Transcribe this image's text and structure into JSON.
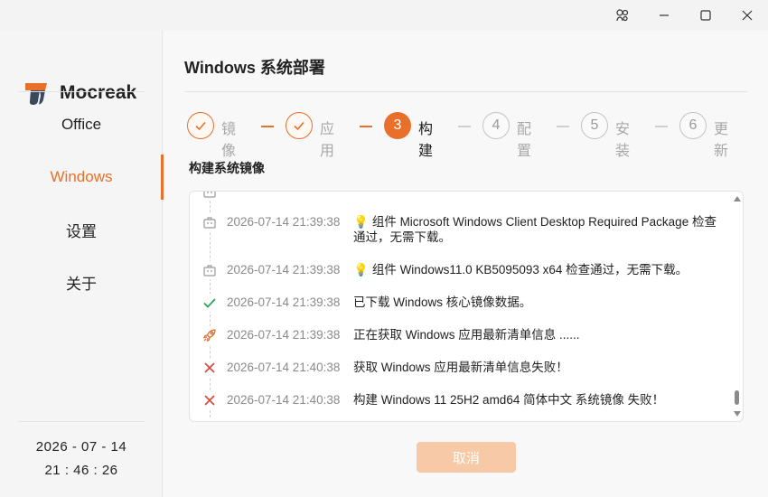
{
  "window": {
    "controls": [
      "settings-icon",
      "minimize-icon",
      "maximize-icon",
      "close-icon"
    ]
  },
  "brand": {
    "name": "Mocreak",
    "accent": "#e8702a"
  },
  "sidebar": {
    "items": [
      {
        "label": "Office",
        "active": false
      },
      {
        "label": "Windows",
        "active": true
      },
      {
        "label": "设置",
        "active": false
      },
      {
        "label": "关于",
        "active": false
      }
    ],
    "clock": {
      "date": "2026 - 07 - 14",
      "time": "21 : 46 : 26"
    }
  },
  "main": {
    "title": "Windows 系统部署",
    "steps": [
      {
        "index": "1",
        "label": "镜像",
        "state": "done"
      },
      {
        "index": "2",
        "label": "应用",
        "state": "done"
      },
      {
        "index": "3",
        "label": "构建",
        "state": "current"
      },
      {
        "index": "4",
        "label": "配置",
        "state": "todo"
      },
      {
        "index": "5",
        "label": "安装",
        "state": "todo"
      },
      {
        "index": "6",
        "label": "更新",
        "state": "todo"
      }
    ],
    "section_title": "构建系统镜像",
    "log": [
      {
        "icon": "package-icon",
        "time": "2026-07-14 21:39:38",
        "message": "组件 Microsoft Windows Client Desktop Required Package 检查通过，无需下载。",
        "bulb": true
      },
      {
        "icon": "package-icon",
        "time": "2026-07-14 21:39:38",
        "message": "组件 Windows11.0 KB5095093 x64 检查通过，无需下载。",
        "bulb": true
      },
      {
        "icon": "check-icon",
        "time": "2026-07-14 21:39:38",
        "message": "已下载 Windows 核心镜像数据。",
        "bulb": false
      },
      {
        "icon": "rocket-icon",
        "time": "2026-07-14 21:39:38",
        "message": "正在获取 Windows 应用最新清单信息 ......",
        "bulb": false
      },
      {
        "icon": "error-icon",
        "time": "2026-07-14 21:40:38",
        "message": "获取 Windows 应用最新清单信息失败！",
        "bulb": false
      },
      {
        "icon": "error-icon",
        "time": "2026-07-14 21:40:38",
        "message": "构建 Windows 11 25H2 amd64 简体中文 系统镜像 失败！",
        "bulb": false
      }
    ],
    "cancel_label": "取消"
  },
  "colors": {
    "accent": "#e8702a",
    "success": "#2aa05a",
    "error": "#d9463c",
    "bulb": "#f2b323"
  }
}
